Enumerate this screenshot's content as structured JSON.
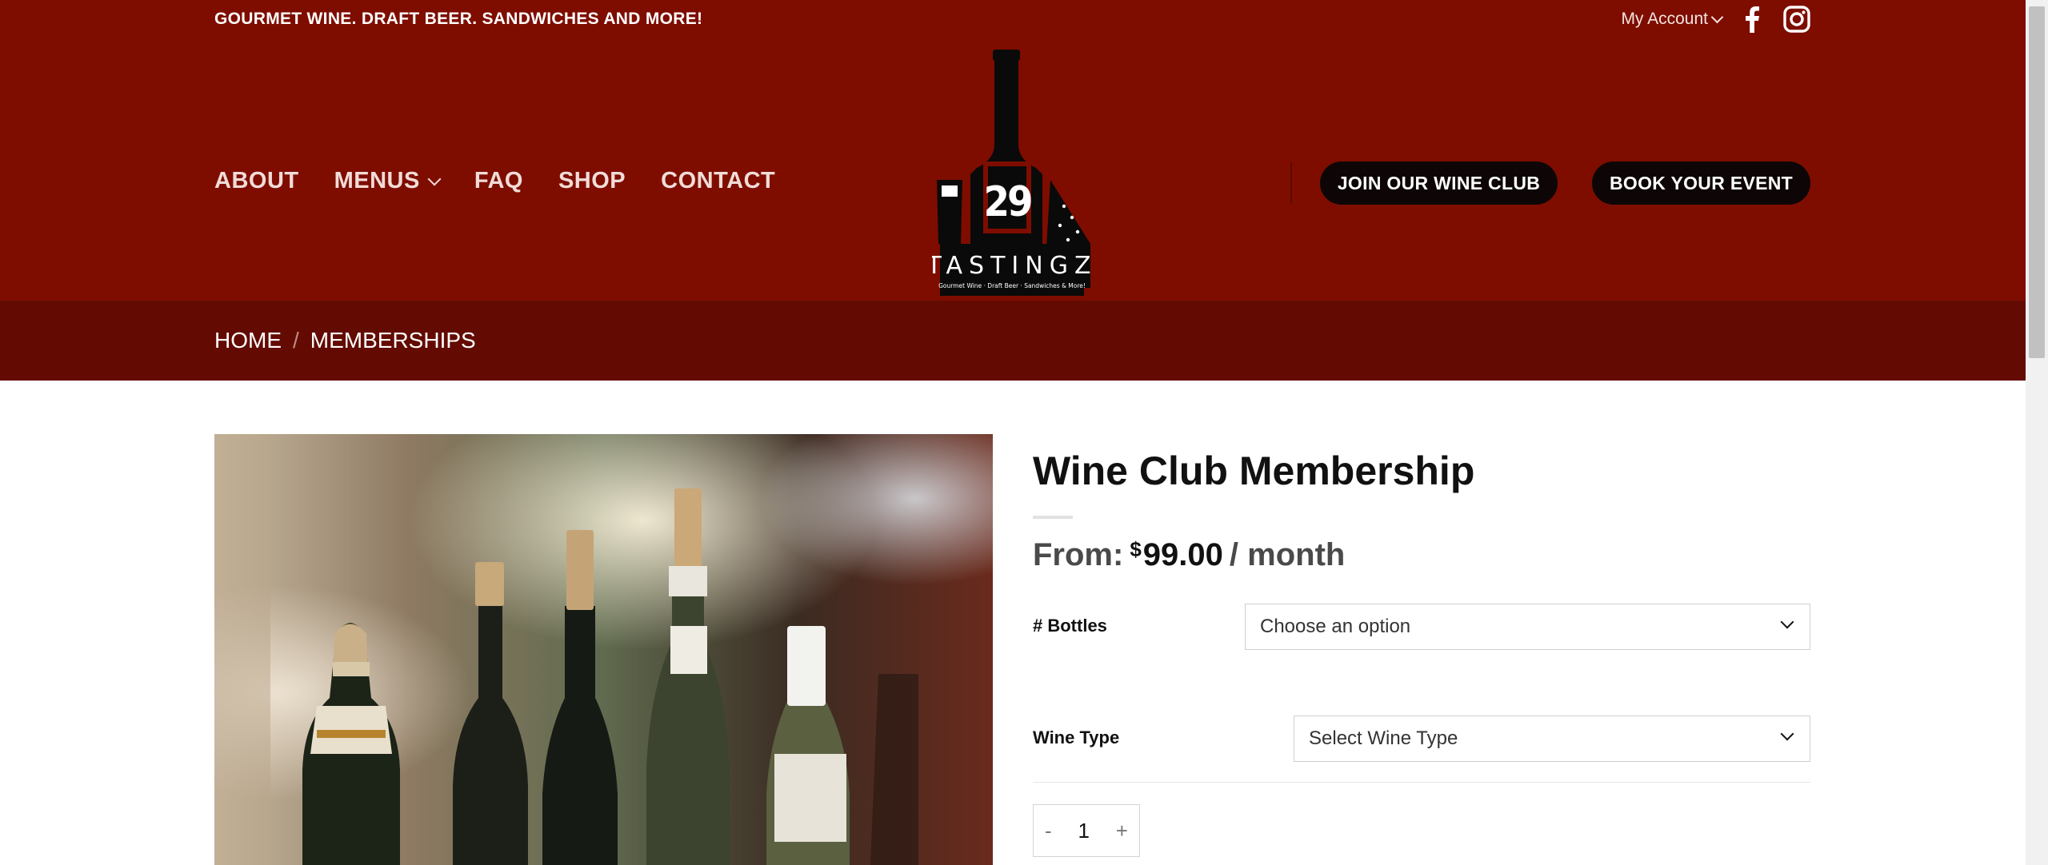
{
  "header": {
    "tagline": "GOURMET WINE. DRAFT BEER. SANDWICHES AND MORE!",
    "my_account": "My Account",
    "nav": [
      {
        "label": "ABOUT"
      },
      {
        "label": "MENUS"
      },
      {
        "label": "FAQ"
      },
      {
        "label": "SHOP"
      },
      {
        "label": "CONTACT"
      }
    ],
    "logo": {
      "number": "29",
      "name": "TASTINGZ",
      "subtitle": "Gourmet Wine · Draft Beer · Sandwiches & More!"
    },
    "cta_join": "JOIN OUR WINE CLUB",
    "cta_book": "BOOK YOUR EVENT",
    "icons": [
      "facebook-icon",
      "instagram-icon",
      "chevron-down-icon"
    ]
  },
  "breadcrumb": {
    "home": "HOME",
    "separator": "/",
    "current": "MEMBERSHIPS"
  },
  "product": {
    "title": "Wine Club Membership",
    "price_prefix": "From:",
    "currency": "$",
    "amount": "99.00",
    "period": "/ month",
    "options": [
      {
        "label": "# Bottles",
        "selected": "Choose an option"
      },
      {
        "label": "Wine Type",
        "selected": "Select Wine Type"
      }
    ],
    "quantity": {
      "minus": "-",
      "value": "1",
      "plus": "+"
    }
  },
  "colors": {
    "header_bg": "#7e0d00",
    "breadcrumb_bg": "#630b03",
    "cta_bg": "#0e0606"
  }
}
